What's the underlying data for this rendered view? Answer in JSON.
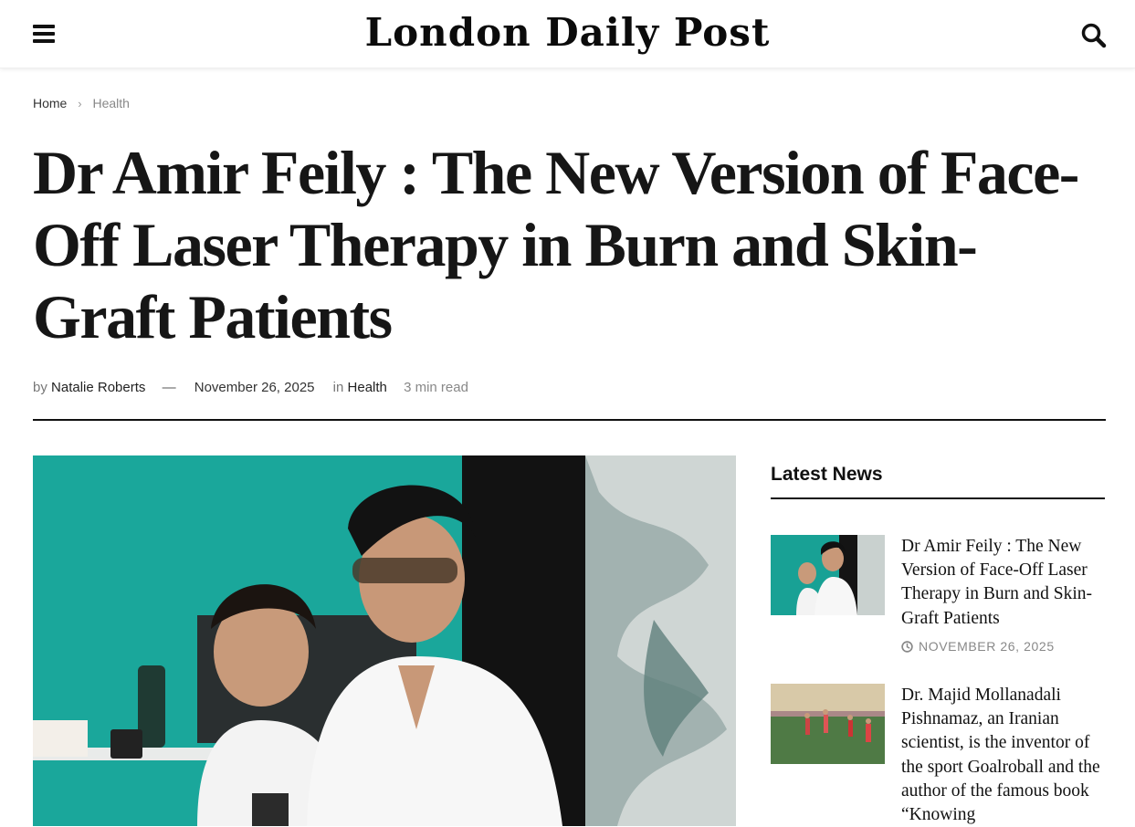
{
  "header": {
    "site_title": "London Daily Post"
  },
  "breadcrumb": {
    "home": "Home",
    "current": "Health"
  },
  "article": {
    "title": "Dr Amir Feily : The New Version of Face-Off Laser Therapy in Burn and Skin-Graft Patients",
    "by": "by",
    "author": "Natalie Roberts",
    "dash": "—",
    "date": "November 26, 2025",
    "in": "in",
    "category": "Health",
    "read_time": "3 min read"
  },
  "sidebar": {
    "heading": "Latest News",
    "items": [
      {
        "title": "Dr Amir Feily : The New Version of Face-Off Laser Therapy in Burn and Skin-Graft Patients",
        "date": "NOVEMBER 26, 2025"
      },
      {
        "title": "Dr. Majid Mollanadali Pishnamaz, an Iranian scientist, is the inventor of the sport Goalroball and the author of the famous book “Knowing"
      }
    ]
  },
  "icons": {
    "menu": "hamburger-menu-icon",
    "search": "search-icon",
    "breadcrumb_separator": "chevron-right-icon",
    "date": "clock-icon"
  }
}
